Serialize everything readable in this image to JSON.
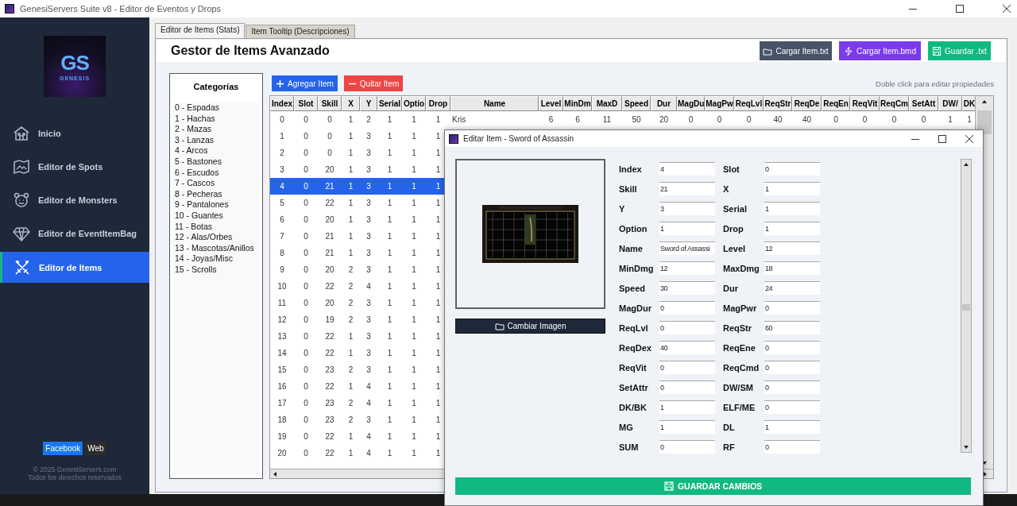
{
  "window": {
    "title": "GenesiServers Suite v8 - Editor de Eventos y Drops"
  },
  "logo": {
    "text": "GS",
    "subtitle": "GENESIS"
  },
  "sidebar": {
    "items": [
      {
        "label": "Inicio",
        "kind": "home",
        "selected": false
      },
      {
        "label": "Editor de Spots",
        "kind": "map",
        "selected": false
      },
      {
        "label": "Editor de Monsters",
        "kind": "monster",
        "selected": false
      },
      {
        "label": "Editor de EventItemBag",
        "kind": "gem",
        "selected": false
      },
      {
        "label": "Editor de Items",
        "kind": "swords",
        "selected": true
      }
    ],
    "links": [
      {
        "label": "Facebook",
        "kind": "primary"
      },
      {
        "label": "Web",
        "kind": "plain"
      }
    ],
    "footer": [
      "© 2025 GenesiServers.com",
      "Todos los derechos reservados"
    ]
  },
  "tabs": [
    {
      "label": "Editor de Items (Stats)",
      "selected": true
    },
    {
      "label": "Item Tooltip (Descripciones)",
      "selected": false
    }
  ],
  "header": {
    "title": "Gestor de Items Avanzado",
    "buttons": [
      {
        "label": "Cargar Item.txt",
        "kind": "load"
      },
      {
        "label": "Cargar Item.bmd",
        "kind": "bmd"
      },
      {
        "label": "Guardar .txt",
        "kind": "save"
      }
    ]
  },
  "categories": {
    "title": "Categorías",
    "items": [
      "0 - Espadas",
      "1 - Hachas",
      "2 - Mazas",
      "3 - Lanzas",
      "4 - Arcos",
      "5 - Bastones",
      "6 - Escudos",
      "7 - Cascos",
      "8 - Pecheras",
      "9 - Pantalones",
      "10 - Guantes",
      "11 - Botas",
      "12 - Alas/Orbes",
      "13 - Mascotas/Anillos",
      "14 - Joyas/Misc",
      "15 - Scrolls"
    ]
  },
  "actions": [
    {
      "label": "Agregar Item",
      "kind": "add"
    },
    {
      "label": "Quitar Item",
      "kind": "remove"
    }
  ],
  "hint": "Doble click para editar propiedades",
  "table": {
    "columns": [
      "Index",
      "Slot",
      "Skill",
      "X",
      "Y",
      "Serial",
      "Optio",
      "Drop",
      "Name",
      "Level",
      "MinDm",
      "MaxD",
      "Speed",
      "Dur",
      "MagDu",
      "MagPw",
      "ReqLvl",
      "ReqStr",
      "ReqDe",
      "ReqEn",
      "ReqVit",
      "ReqCm",
      "SetAtt",
      "DW/",
      "DK"
    ],
    "rows": [
      {
        "selected": false,
        "cells": [
          "0",
          "0",
          "0",
          "1",
          "2",
          "1",
          "1",
          "1",
          "Kris",
          "6",
          "6",
          "11",
          "50",
          "20",
          "0",
          "0",
          "0",
          "40",
          "40",
          "0",
          "0",
          "0",
          "0",
          "1",
          "1"
        ]
      },
      {
        "selected": false,
        "cells": [
          "1",
          "0",
          "0",
          "1",
          "3",
          "1",
          "1",
          "1"
        ]
      },
      {
        "selected": false,
        "cells": [
          "2",
          "0",
          "0",
          "1",
          "3",
          "1",
          "1",
          "1"
        ]
      },
      {
        "selected": false,
        "cells": [
          "3",
          "0",
          "20",
          "1",
          "3",
          "1",
          "1",
          "1"
        ]
      },
      {
        "selected": true,
        "cells": [
          "4",
          "0",
          "21",
          "1",
          "3",
          "1",
          "1",
          "1"
        ]
      },
      {
        "selected": false,
        "cells": [
          "5",
          "0",
          "22",
          "1",
          "3",
          "1",
          "1",
          "1"
        ]
      },
      {
        "selected": false,
        "cells": [
          "6",
          "0",
          "20",
          "1",
          "3",
          "1",
          "1",
          "1"
        ]
      },
      {
        "selected": false,
        "cells": [
          "7",
          "0",
          "21",
          "1",
          "3",
          "1",
          "1",
          "1"
        ]
      },
      {
        "selected": false,
        "cells": [
          "8",
          "0",
          "21",
          "1",
          "3",
          "1",
          "1",
          "1"
        ]
      },
      {
        "selected": false,
        "cells": [
          "9",
          "0",
          "20",
          "2",
          "3",
          "1",
          "1",
          "1"
        ]
      },
      {
        "selected": false,
        "cells": [
          "10",
          "0",
          "22",
          "2",
          "4",
          "1",
          "1",
          "1"
        ]
      },
      {
        "selected": false,
        "cells": [
          "11",
          "0",
          "20",
          "2",
          "3",
          "1",
          "1",
          "1"
        ]
      },
      {
        "selected": false,
        "cells": [
          "12",
          "0",
          "19",
          "2",
          "3",
          "1",
          "1",
          "1"
        ]
      },
      {
        "selected": false,
        "cells": [
          "13",
          "0",
          "22",
          "1",
          "3",
          "1",
          "1",
          "1"
        ]
      },
      {
        "selected": false,
        "cells": [
          "14",
          "0",
          "22",
          "1",
          "3",
          "1",
          "1",
          "1"
        ]
      },
      {
        "selected": false,
        "cells": [
          "15",
          "0",
          "23",
          "2",
          "3",
          "1",
          "1",
          "1"
        ]
      },
      {
        "selected": false,
        "cells": [
          "16",
          "0",
          "22",
          "1",
          "4",
          "1",
          "1",
          "1"
        ]
      },
      {
        "selected": false,
        "cells": [
          "17",
          "0",
          "23",
          "2",
          "4",
          "1",
          "1",
          "1"
        ]
      },
      {
        "selected": false,
        "cells": [
          "18",
          "0",
          "23",
          "2",
          "3",
          "1",
          "1",
          "1"
        ]
      },
      {
        "selected": false,
        "cells": [
          "19",
          "0",
          "22",
          "1",
          "4",
          "1",
          "1",
          "1"
        ]
      },
      {
        "selected": false,
        "cells": [
          "20",
          "0",
          "22",
          "1",
          "4",
          "1",
          "1",
          "1"
        ]
      }
    ]
  },
  "dialog": {
    "title": "Editar Item - Sword of Assassin",
    "image_button": "Cambiar Imagen",
    "fields": [
      {
        "label": "Index",
        "value": "4"
      },
      {
        "label": "Slot",
        "value": "0"
      },
      {
        "label": "Skill",
        "value": "21"
      },
      {
        "label": "X",
        "value": "1"
      },
      {
        "label": "Y",
        "value": "3"
      },
      {
        "label": "Serial",
        "value": "1"
      },
      {
        "label": "Option",
        "value": "1"
      },
      {
        "label": "Drop",
        "value": "1"
      },
      {
        "label": "Name",
        "value": "Sword of Assassi"
      },
      {
        "label": "Level",
        "value": "12"
      },
      {
        "label": "MinDmg",
        "value": "12"
      },
      {
        "label": "MaxDmg",
        "value": "18"
      },
      {
        "label": "Speed",
        "value": "30"
      },
      {
        "label": "Dur",
        "value": "24"
      },
      {
        "label": "MagDur",
        "value": "0"
      },
      {
        "label": "MagPwr",
        "value": "0"
      },
      {
        "label": "ReqLvl",
        "value": "0"
      },
      {
        "label": "ReqStr",
        "value": "60"
      },
      {
        "label": "ReqDex",
        "value": "40"
      },
      {
        "label": "ReqEne",
        "value": "0"
      },
      {
        "label": "ReqVit",
        "value": "0"
      },
      {
        "label": "ReqCmd",
        "value": "0"
      },
      {
        "label": "SetAttr",
        "value": "0"
      },
      {
        "label": "DW/SM",
        "value": "0"
      },
      {
        "label": "DK/BK",
        "value": "1"
      },
      {
        "label": "ELF/ME",
        "value": "0"
      },
      {
        "label": "MG",
        "value": "1"
      },
      {
        "label": "DL",
        "value": "1"
      },
      {
        "label": "SUM",
        "value": "0"
      },
      {
        "label": "RF",
        "value": "0"
      }
    ],
    "save_button": "GUARDAR CAMBIOS"
  }
}
